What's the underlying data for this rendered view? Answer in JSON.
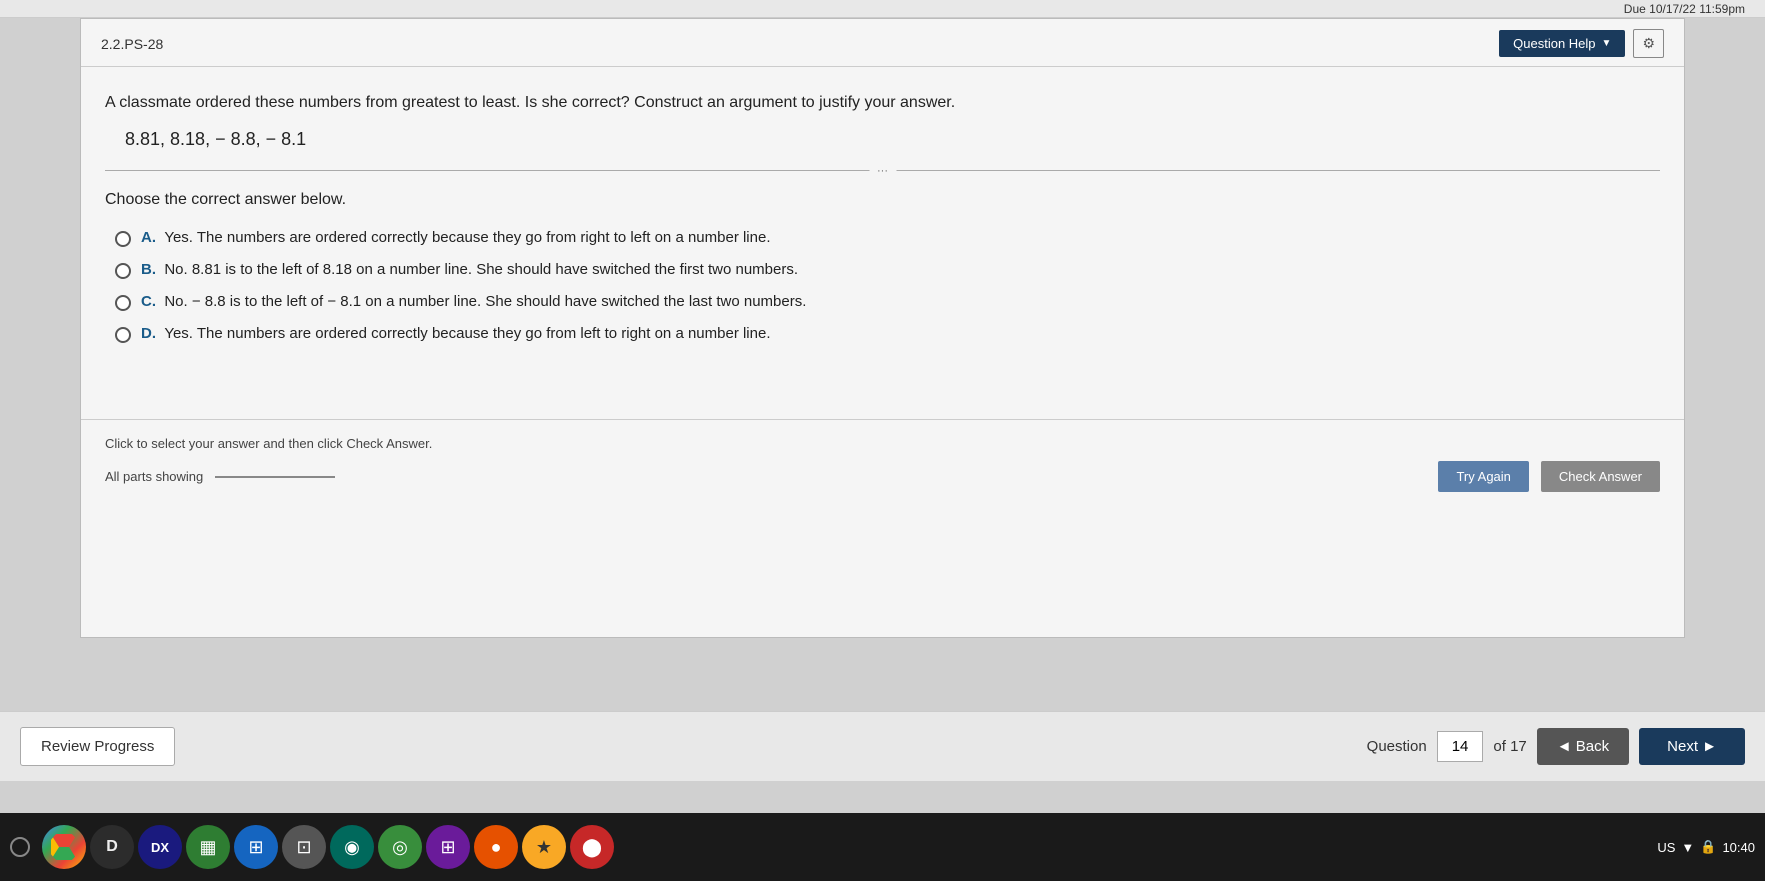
{
  "topBar": {
    "dueDate": "Due 10/17/22 11:59pm"
  },
  "question": {
    "id": "2.2.PS-28",
    "helpButton": "Question Help",
    "questionText": "A classmate ordered these numbers from greatest to least. Is she correct? Construct an argument to justify your answer.",
    "numbersDisplay": "8.81, 8.18,  − 8.8,  − 8.1",
    "dividerDots": "···",
    "chooseLabel": "Choose the correct answer below.",
    "options": [
      {
        "letter": "A.",
        "text": "Yes. The numbers are ordered correctly because they go from right to left on a number line."
      },
      {
        "letter": "B.",
        "text": "No. 8.81 is to the left of 8.18 on a number line. She should have switched the first two numbers."
      },
      {
        "letter": "C.",
        "text": "No.  − 8.8 is to the left of  − 8.1 on a number line. She should have switched the last two numbers."
      },
      {
        "letter": "D.",
        "text": "Yes. The numbers are ordered correctly because they go from left to right on a number line."
      }
    ],
    "clickInstruction": "Click to select your answer and then click Check Answer.",
    "allPartsLabel": "All parts showing",
    "tryAgainLabel": "Try Again",
    "checkAnswerLabel": "Check Answer"
  },
  "footer": {
    "reviewProgressLabel": "Review Progress",
    "questionLabel": "Question",
    "currentQuestion": "14",
    "totalQuestions": "of 17",
    "backLabel": "◄ Back",
    "nextLabel": "Next ►"
  },
  "taskbar": {
    "time": "10:40",
    "locale": "US"
  }
}
